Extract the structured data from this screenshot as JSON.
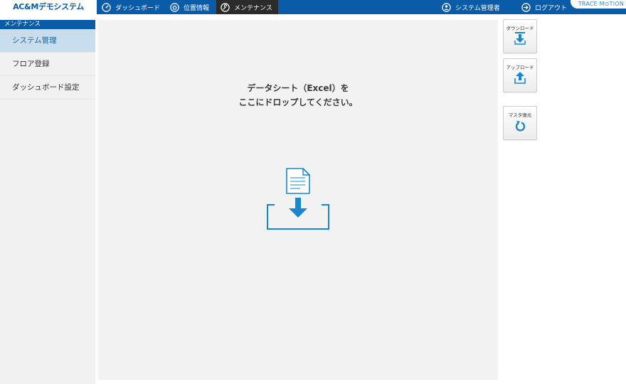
{
  "app": {
    "brand": "AC&Mデモシステム",
    "logo_text": "TRACE M⊙TION"
  },
  "nav": {
    "items": [
      {
        "label": "ダッシュボード",
        "icon": "dashboard-icon"
      },
      {
        "label": "位置情報",
        "icon": "home-icon"
      },
      {
        "label": "メンテナンス",
        "icon": "wrench-icon",
        "active": true
      }
    ],
    "user": {
      "label": "システム管理者",
      "icon": "user-icon"
    },
    "logout": {
      "label": "ログアウト",
      "icon": "logout-icon"
    }
  },
  "sidebar": {
    "header": "メンテナンス",
    "items": [
      {
        "label": "システム管理",
        "active": true
      },
      {
        "label": "フロア登録"
      },
      {
        "label": "ダッシュボード設定"
      }
    ]
  },
  "dropzone": {
    "line1": "データシート（Excel）を",
    "line2": "ここにドロップしてください。",
    "icon": "file-drop-icon"
  },
  "actions": [
    {
      "label": "ダウンロード",
      "icon": "download-icon"
    },
    {
      "label": "アップロード",
      "icon": "upload-icon"
    },
    {
      "label": "マスタ復元",
      "icon": "restore-icon"
    }
  ],
  "colors": {
    "primary": "#0a5ca8",
    "accent": "#1a86d0",
    "active_nav": "#2b2b2b",
    "sidebar_active": "#c8ddee"
  }
}
